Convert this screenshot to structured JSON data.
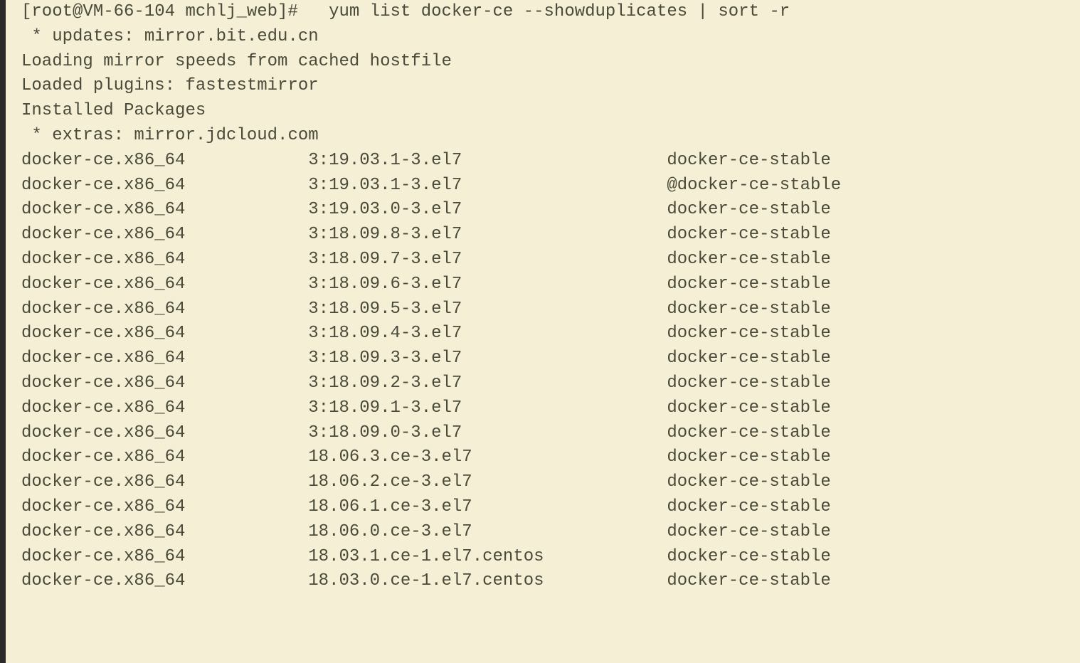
{
  "prompt": "[root@VM-66-104 mchlj_web]#   yum list docker-ce --showduplicates | sort -r",
  "header_lines": [
    " * updates: mirror.bit.edu.cn",
    "Loading mirror speeds from cached hostfile",
    "Loaded plugins: fastestmirror",
    "Installed Packages",
    " * extras: mirror.jdcloud.com"
  ],
  "packages": [
    {
      "name": "docker-ce.x86_64",
      "version": "3:19.03.1-3.el7",
      "repo": "docker-ce-stable"
    },
    {
      "name": "docker-ce.x86_64",
      "version": "3:19.03.1-3.el7",
      "repo": "@docker-ce-stable"
    },
    {
      "name": "docker-ce.x86_64",
      "version": "3:19.03.0-3.el7",
      "repo": "docker-ce-stable"
    },
    {
      "name": "docker-ce.x86_64",
      "version": "3:18.09.8-3.el7",
      "repo": "docker-ce-stable"
    },
    {
      "name": "docker-ce.x86_64",
      "version": "3:18.09.7-3.el7",
      "repo": "docker-ce-stable"
    },
    {
      "name": "docker-ce.x86_64",
      "version": "3:18.09.6-3.el7",
      "repo": "docker-ce-stable"
    },
    {
      "name": "docker-ce.x86_64",
      "version": "3:18.09.5-3.el7",
      "repo": "docker-ce-stable"
    },
    {
      "name": "docker-ce.x86_64",
      "version": "3:18.09.4-3.el7",
      "repo": "docker-ce-stable"
    },
    {
      "name": "docker-ce.x86_64",
      "version": "3:18.09.3-3.el7",
      "repo": "docker-ce-stable"
    },
    {
      "name": "docker-ce.x86_64",
      "version": "3:18.09.2-3.el7",
      "repo": "docker-ce-stable"
    },
    {
      "name": "docker-ce.x86_64",
      "version": "3:18.09.1-3.el7",
      "repo": "docker-ce-stable"
    },
    {
      "name": "docker-ce.x86_64",
      "version": "3:18.09.0-3.el7",
      "repo": "docker-ce-stable"
    },
    {
      "name": "docker-ce.x86_64",
      "version": "18.06.3.ce-3.el7",
      "repo": "docker-ce-stable"
    },
    {
      "name": "docker-ce.x86_64",
      "version": "18.06.2.ce-3.el7",
      "repo": "docker-ce-stable"
    },
    {
      "name": "docker-ce.x86_64",
      "version": "18.06.1.ce-3.el7",
      "repo": "docker-ce-stable"
    },
    {
      "name": "docker-ce.x86_64",
      "version": "18.06.0.ce-3.el7",
      "repo": "docker-ce-stable"
    },
    {
      "name": "docker-ce.x86_64",
      "version": "18.03.1.ce-1.el7.centos",
      "repo": "docker-ce-stable"
    },
    {
      "name": "docker-ce.x86_64",
      "version": "18.03.0.ce-1.el7.centos",
      "repo": "docker-ce-stable"
    }
  ]
}
